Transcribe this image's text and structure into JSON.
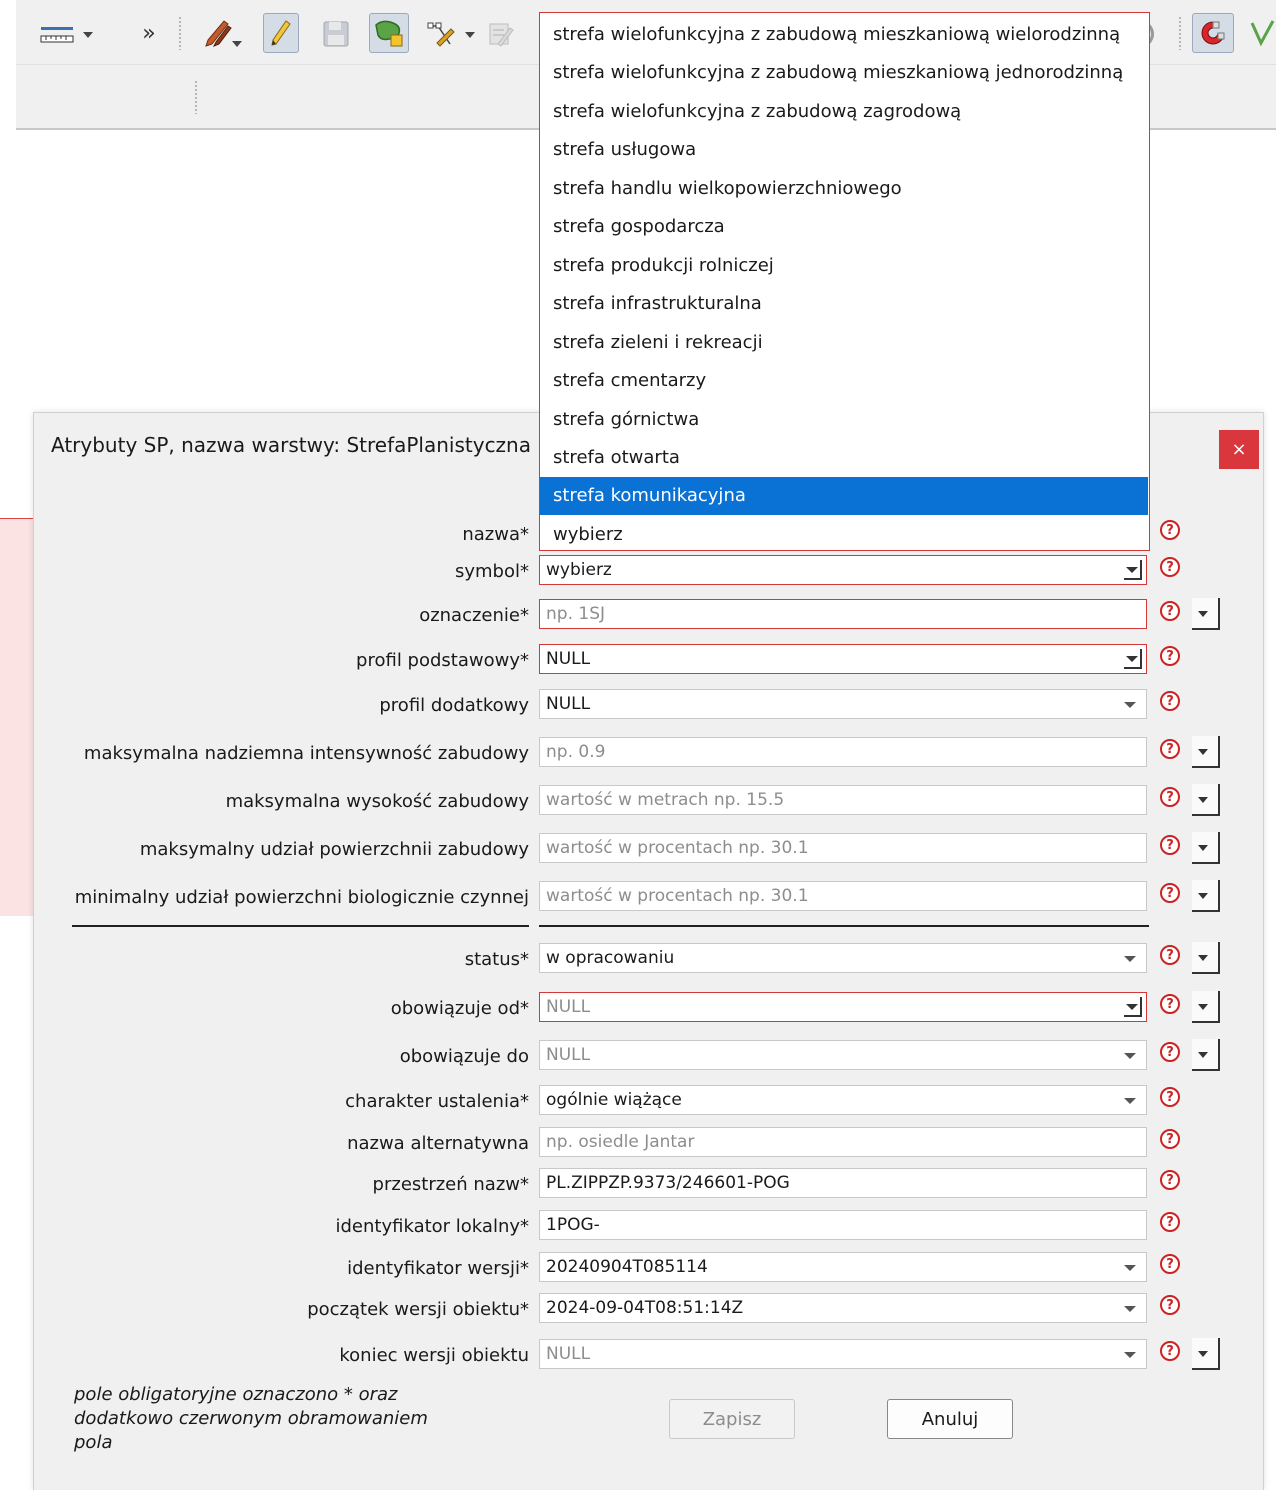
{
  "toolbar": {
    "icons": [
      "measure-icon",
      "overflow-chevrons-icon",
      "digitize-pencils-icon",
      "toggle-editing-icon",
      "save-edits-icon",
      "add-polygon-icon",
      "vertex-tool-icon",
      "attribute-edit-icon",
      "magnet-snapping-icon"
    ],
    "overflow": "»"
  },
  "dialog": {
    "title": "Atrybuty SP, nazwa warstwy: StrefaPlanistyczna",
    "close": "×",
    "help": "?",
    "rows": [
      {
        "label": "nazwa*",
        "value": ""
      },
      {
        "label": "symbol*",
        "value": "wybierz"
      },
      {
        "label": "oznaczenie*",
        "placeholder": "np. 1SJ"
      },
      {
        "label": "profil podstawowy*",
        "value": "NULL"
      },
      {
        "label": "profil dodatkowy",
        "value": "NULL"
      },
      {
        "label": "maksymalna nadziemna intensywność zabudowy",
        "placeholder": "np. 0.9"
      },
      {
        "label": "maksymalna wysokość zabudowy",
        "placeholder": "wartość w metrach np. 15.5"
      },
      {
        "label": "maksymalny udział powierzchnii zabudowy",
        "placeholder": "wartość w procentach np. 30.1"
      },
      {
        "label": "minimalny udział powierzchni biologicznie czynnej",
        "placeholder": "wartość w procentach np. 30.1"
      },
      {
        "label": "status*",
        "value": "w opracowaniu"
      },
      {
        "label": "obowiązuje od*",
        "value": "NULL"
      },
      {
        "label": "obowiązuje do",
        "value": "NULL"
      },
      {
        "label": "charakter ustalenia*",
        "value": "ogólnie wiążące"
      },
      {
        "label": "nazwa alternatywna",
        "placeholder": "np. osiedle Jantar"
      },
      {
        "label": "przestrzeń nazw*",
        "value": "PL.ZIPPZP.9373/246601-POG"
      },
      {
        "label": "identyfikator lokalny*",
        "value": "1POG-"
      },
      {
        "label": "identyfikator wersji*",
        "value": "20240904T085114"
      },
      {
        "label": "początek wersji obiektu*",
        "value": "2024-09-04T08:51:14Z"
      },
      {
        "label": "koniec wersji obiektu",
        "value": "NULL"
      }
    ],
    "footnote": "pole obligatoryjne oznaczono * oraz dodatkowo czerwonym obramowaniem pola",
    "save_label": "Zapisz",
    "cancel_label": "Anuluj"
  },
  "dropdown": {
    "options": [
      "strefa wielofunkcyjna z zabudową mieszkaniową wielorodzinną",
      "strefa wielofunkcyjna z zabudową mieszkaniową jednorodzinną",
      "strefa wielofunkcyjna z zabudową zagrodową",
      "strefa usługowa",
      "strefa handlu wielkopowierzchniowego",
      "strefa gospodarcza",
      "strefa produkcji rolniczej",
      "strefa infrastrukturalna",
      "strefa zieleni i rekreacji",
      "strefa cmentarzy",
      "strefa górnictwa",
      "strefa otwarta",
      "strefa komunikacyjna",
      "wybierz"
    ],
    "selected": "strefa komunikacyjna"
  },
  "colors": {
    "required_border": "#d43838",
    "selection": "#0a72d4",
    "close_button": "#d9363e",
    "help_icon": "#cc2222"
  }
}
